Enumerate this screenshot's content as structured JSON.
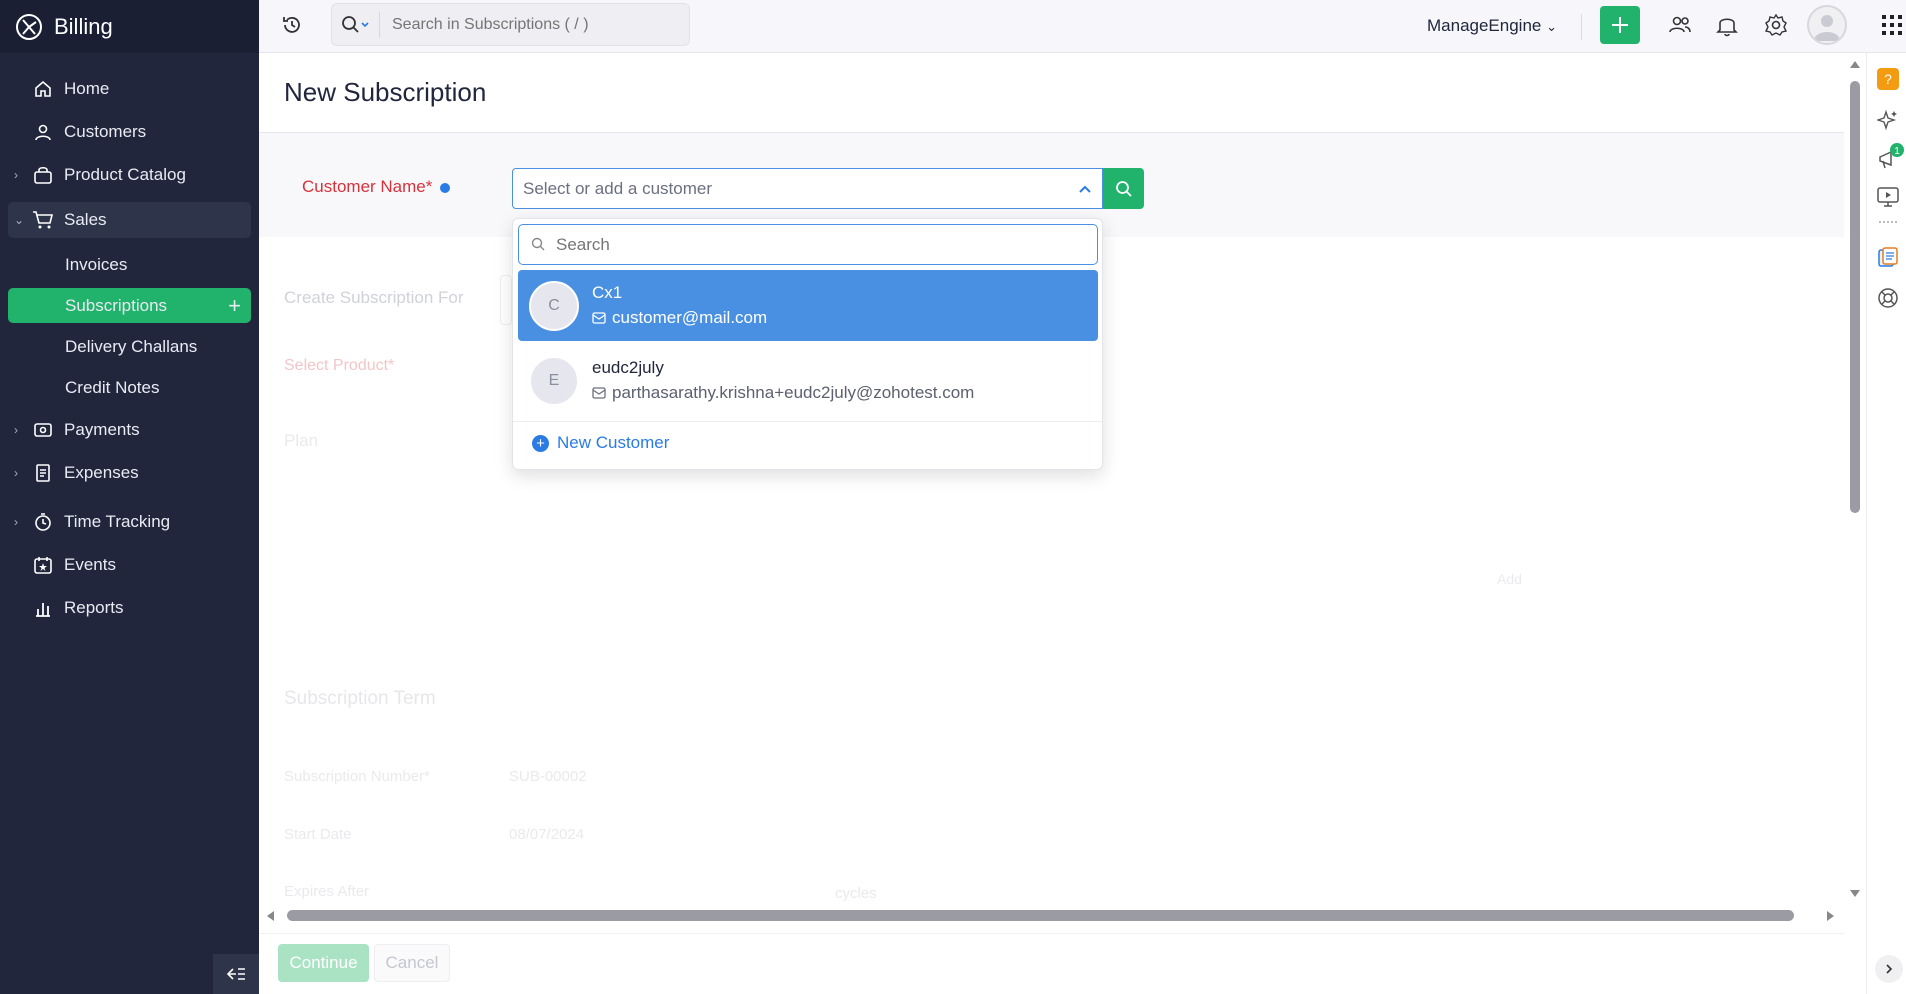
{
  "app": {
    "title": "Billing"
  },
  "sidebar": {
    "items": [
      {
        "label": "Home"
      },
      {
        "label": "Customers"
      },
      {
        "label": "Product Catalog"
      },
      {
        "label": "Sales"
      },
      {
        "label": "Invoices"
      },
      {
        "label": "Subscriptions"
      },
      {
        "label": "Delivery Challans"
      },
      {
        "label": "Credit Notes"
      },
      {
        "label": "Payments"
      },
      {
        "label": "Expenses"
      },
      {
        "label": "Time Tracking"
      },
      {
        "label": "Events"
      },
      {
        "label": "Reports"
      }
    ]
  },
  "header": {
    "search_placeholder": "Search in Subscriptions ( / )",
    "org_name": "ManageEngine",
    "notification_count": "1"
  },
  "page": {
    "title": "New Subscription",
    "customer_label": "Customer Name*",
    "customer_placeholder": "Select or add a customer",
    "faded": {
      "create_for": "Create Subscription For",
      "select_product": "Select Product*",
      "plan": "Plan",
      "addon_hint": "Add",
      "term": "Subscription Term",
      "sub_number_label": "Subscription Number*",
      "sub_number_value": "SUB-00002",
      "start_date_label": "Start Date",
      "start_date_value": "08/07/2024",
      "expires_label": "Expires After",
      "expires_unit": "cycles"
    }
  },
  "dropdown": {
    "search_placeholder": "Search",
    "options": [
      {
        "initial": "C",
        "name": "Cx1",
        "email": "customer@mail.com"
      },
      {
        "initial": "E",
        "name": "eudc2july",
        "email": "parthasarathy.krishna+eudc2july@zohotest.com"
      }
    ],
    "new_customer_label": "New Customer"
  },
  "footer": {
    "continue_label": "Continue",
    "cancel_label": "Cancel"
  },
  "colors": {
    "sidebar_bg": "#21263c",
    "accent_green": "#21b26b",
    "accent_blue": "#4a90e2",
    "required_red": "#d6333b"
  }
}
